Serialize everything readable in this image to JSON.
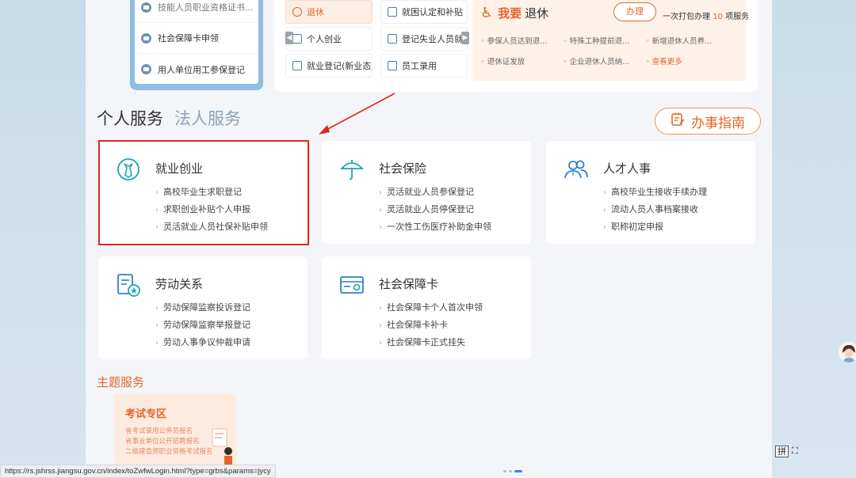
{
  "left_list": {
    "items": [
      {
        "label": "技能人员职业资格证书...",
        "icon": "card-icon"
      },
      {
        "label": "社会保障卡申领",
        "icon": "card-icon"
      },
      {
        "label": "用人单位用工参保登记",
        "icon": "form-icon"
      }
    ]
  },
  "quick_grid": [
    {
      "label": "退休",
      "active": true
    },
    {
      "label": "就困认定和补贴",
      "active": false
    },
    {
      "label": "个人创业",
      "active": false
    },
    {
      "label": "登记失业人员就业",
      "active": false
    },
    {
      "label": "就业登记(新业态人...",
      "active": false
    },
    {
      "label": "员工录用",
      "active": false
    }
  ],
  "retire_panel": {
    "title_a": "我要",
    "title_b": "退休",
    "button": "办理",
    "pack_text_a": "一次打包办理",
    "pack_count": "10",
    "pack_text_b": "项服务",
    "links": [
      "参保人员达到退...",
      "特殊工种提前退...",
      "新增退休人员养...",
      "退休证发放",
      "企业退休人员纳...",
      "查看更多"
    ]
  },
  "service_tabs": {
    "personal": "个人服务",
    "corporate": "法人服务"
  },
  "guide_button": "办事指南",
  "cards": [
    {
      "title": "就业创业",
      "icon": "tie-icon",
      "links": [
        "高校毕业生求职登记",
        "求职创业补贴个人申报",
        "灵活就业人员社保补贴申领"
      ]
    },
    {
      "title": "社会保险",
      "icon": "umbrella-icon",
      "links": [
        "灵活就业人员参保登记",
        "灵活就业人员停保登记",
        "一次性工伤医疗补助金申领"
      ]
    },
    {
      "title": "人才人事",
      "icon": "people-icon",
      "links": [
        "高校毕业生接收手续办理",
        "流动人员人事档案接收",
        "职称初定申报"
      ]
    },
    {
      "title": "劳动关系",
      "icon": "document-star-icon",
      "links": [
        "劳动保障监察投诉登记",
        "劳动保障监察举报登记",
        "劳动人事争议仲裁申请"
      ]
    },
    {
      "title": "社会保障卡",
      "icon": "id-card-icon",
      "links": [
        "社会保障卡个人首次申领",
        "社会保障卡补卡",
        "社会保障卡正式挂失"
      ]
    }
  ],
  "theme": {
    "title": "主题服务",
    "exam_title": "考试专区",
    "exam_lines": [
      "省考试录用公务员报名",
      "省事业单位公开招聘报名",
      "二级建造师职业资格考试报名"
    ]
  },
  "status_url": "https://rs.jshrss.jiangsu.gov.cn/index/toZwfwLogin.html?type=grbs&params=jycy",
  "ime_label": "拼",
  "colors": {
    "accent": "#e2672c",
    "link_blue": "#3e86d8",
    "highlight": "#e0251b"
  }
}
